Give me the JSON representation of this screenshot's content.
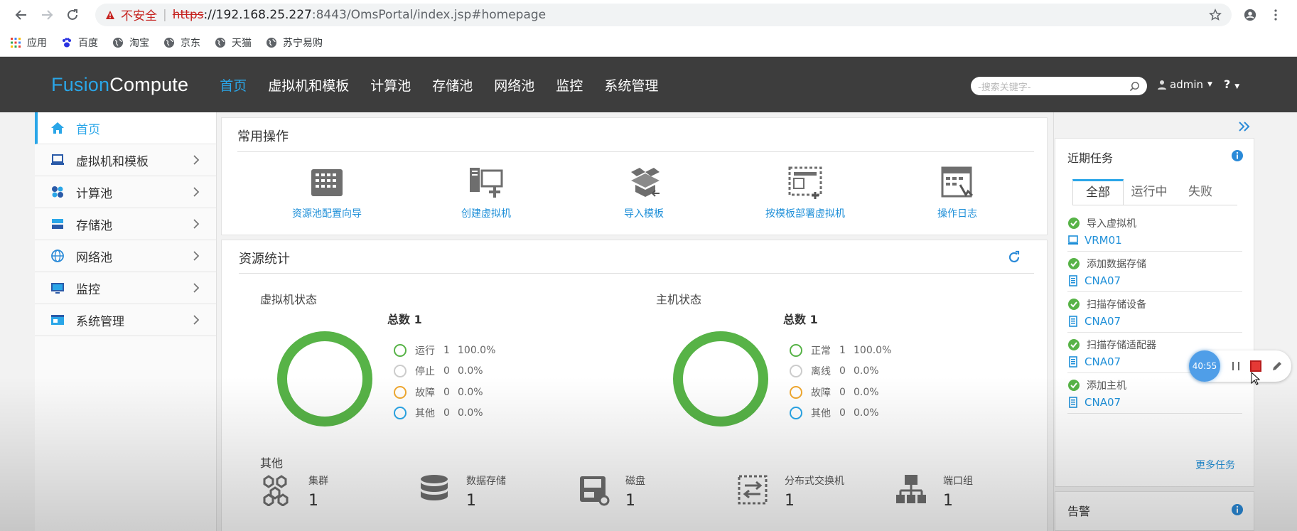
{
  "browser": {
    "security_label": "不安全",
    "url_scheme": "https",
    "url_host": "://192.168.25.227",
    "url_rest": ":8443/OmsPortal/index.jsp#homepage",
    "bookmarks": [
      "应用",
      "百度",
      "淘宝",
      "京东",
      "天猫",
      "苏宁易购"
    ]
  },
  "header": {
    "logo_fusion": "Fusion",
    "logo_compute": "Compute",
    "nav": [
      "首页",
      "虚拟机和模板",
      "计算池",
      "存储池",
      "网络池",
      "监控",
      "系统管理"
    ],
    "search_placeholder": "-搜索关键字-",
    "user": "admin",
    "help": "?"
  },
  "sidebar": {
    "items": [
      {
        "label": "首页",
        "icon": "home-icon"
      },
      {
        "label": "虚拟机和模板",
        "icon": "monitor-icon"
      },
      {
        "label": "计算池",
        "icon": "compute-pool-icon"
      },
      {
        "label": "存储池",
        "icon": "storage-pool-icon"
      },
      {
        "label": "网络池",
        "icon": "globe-icon"
      },
      {
        "label": "监控",
        "icon": "monitor-screen-icon"
      },
      {
        "label": "系统管理",
        "icon": "system-admin-icon"
      }
    ]
  },
  "ops": {
    "title": "常用操作",
    "items": [
      "资源池配置向导",
      "创建虚拟机",
      "导入模板",
      "按模板部署虚拟机",
      "操作日志"
    ]
  },
  "stats": {
    "title": "资源统计",
    "vm": {
      "title": "虚拟机状态",
      "total": "总数 1",
      "legend": [
        {
          "name": "运行",
          "count": "1",
          "pct": "100.0%",
          "color": "#57b347"
        },
        {
          "name": "停止",
          "count": "0",
          "pct": "0.0%",
          "color": "#cccccc"
        },
        {
          "name": "故障",
          "count": "0",
          "pct": "0.0%",
          "color": "#f0a830"
        },
        {
          "name": "其他",
          "count": "0",
          "pct": "0.0%",
          "color": "#2aa6e8"
        }
      ]
    },
    "host": {
      "title": "主机状态",
      "total": "总数 1",
      "legend": [
        {
          "name": "正常",
          "count": "1",
          "pct": "100.0%",
          "color": "#57b347"
        },
        {
          "name": "离线",
          "count": "0",
          "pct": "0.0%",
          "color": "#cccccc"
        },
        {
          "name": "故障",
          "count": "0",
          "pct": "0.0%",
          "color": "#f0a830"
        },
        {
          "name": "其他",
          "count": "0",
          "pct": "0.0%",
          "color": "#2aa6e8"
        }
      ]
    },
    "other": {
      "title": "其他",
      "items": [
        {
          "name": "集群",
          "value": "1"
        },
        {
          "name": "数据存储",
          "value": "1"
        },
        {
          "name": "磁盘",
          "value": "1"
        },
        {
          "name": "分布式交换机",
          "value": "1"
        },
        {
          "name": "端口组",
          "value": "1"
        }
      ]
    }
  },
  "tasks": {
    "title": "近期任务",
    "tabs": [
      "全部",
      "运行中",
      "失败"
    ],
    "items": [
      {
        "name": "导入虚拟机",
        "resource": "VRM01",
        "resource_icon": "vm-icon"
      },
      {
        "name": "添加数据存储",
        "resource": "CNA07",
        "resource_icon": "host-icon"
      },
      {
        "name": "扫描存储设备",
        "resource": "CNA07",
        "resource_icon": "host-icon"
      },
      {
        "name": "扫描存储适配器",
        "resource": "CNA07",
        "resource_icon": "host-icon"
      },
      {
        "name": "添加主机",
        "resource": "CNA07",
        "resource_icon": "host-icon"
      }
    ],
    "more": "更多任务"
  },
  "alarm": {
    "title": "告警"
  },
  "recorder": {
    "timer": "40:55"
  },
  "colors": {
    "accent": "#2aa6e8",
    "header_bg": "#3d3d3d",
    "success": "#57b347",
    "link": "#1e8fd8"
  }
}
